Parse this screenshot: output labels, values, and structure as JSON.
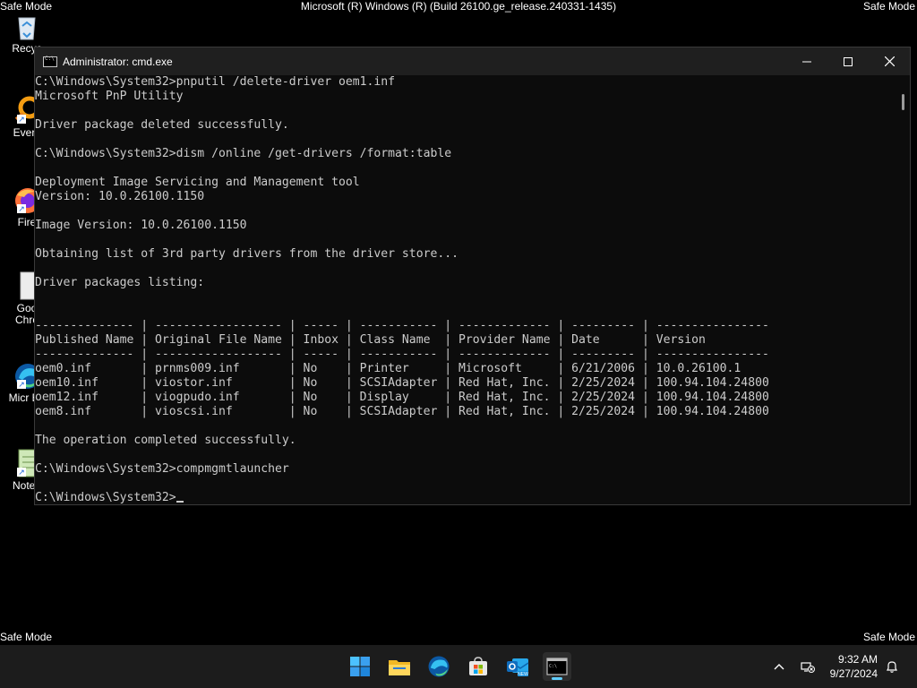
{
  "desktop": {
    "safe_mode_label": "Safe Mode",
    "build_text": "Microsoft (R) Windows (R) (Build 26100.ge_release.240331-1435)",
    "icons": [
      {
        "label": "Recyc",
        "icon": "recycle-bin-icon"
      },
      {
        "label": "Every",
        "icon": "everything-icon"
      },
      {
        "label": "Fire",
        "icon": "firefox-icon"
      },
      {
        "label": "Goo Chro",
        "icon": "chrome-icon"
      },
      {
        "label": "Micr Ed",
        "icon": "edge-icon"
      },
      {
        "label": "Notep",
        "icon": "notepad-icon"
      }
    ]
  },
  "window": {
    "title": "Administrator: cmd.exe",
    "minimize": "—",
    "maximize": "☐",
    "close": "✕",
    "lines": [
      "C:\\Windows\\System32>pnputil /delete-driver oem1.inf",
      "Microsoft PnP Utility",
      "",
      "Driver package deleted successfully.",
      "",
      "C:\\Windows\\System32>dism /online /get-drivers /format:table",
      "",
      "Deployment Image Servicing and Management tool",
      "Version: 10.0.26100.1150",
      "",
      "Image Version: 10.0.26100.1150",
      "",
      "Obtaining list of 3rd party drivers from the driver store...",
      "",
      "Driver packages listing:",
      "",
      "",
      "-------------- | ------------------ | ----- | ----------- | ------------- | --------- | ----------------",
      "Published Name | Original File Name | Inbox | Class Name  | Provider Name | Date      | Version",
      "-------------- | ------------------ | ----- | ----------- | ------------- | --------- | ----------------",
      "oem0.inf       | prnms009.inf       | No    | Printer     | Microsoft     | 6/21/2006 | 10.0.26100.1",
      "oem10.inf      | viostor.inf        | No    | SCSIAdapter | Red Hat, Inc. | 2/25/2024 | 100.94.104.24800",
      "oem12.inf      | viogpudo.inf       | No    | Display     | Red Hat, Inc. | 2/25/2024 | 100.94.104.24800",
      "oem8.inf       | vioscsi.inf        | No    | SCSIAdapter | Red Hat, Inc. | 2/25/2024 | 100.94.104.24800",
      "",
      "The operation completed successfully.",
      "",
      "C:\\Windows\\System32>compmgmtlauncher",
      "",
      "C:\\Windows\\System32>"
    ]
  },
  "taskbar": {
    "apps": [
      {
        "name": "start-button",
        "icon": "windows-logo-icon"
      },
      {
        "name": "file-explorer-button",
        "icon": "folder-icon"
      },
      {
        "name": "edge-button",
        "icon": "edge-icon"
      },
      {
        "name": "store-button",
        "icon": "store-icon"
      },
      {
        "name": "outlook-button",
        "icon": "outlook-icon"
      },
      {
        "name": "terminal-button",
        "icon": "terminal-icon"
      }
    ],
    "tray": {
      "chevron": "^",
      "time": "9:32 AM",
      "date": "9/27/2024"
    },
    "accent_color": "#60cdff"
  }
}
